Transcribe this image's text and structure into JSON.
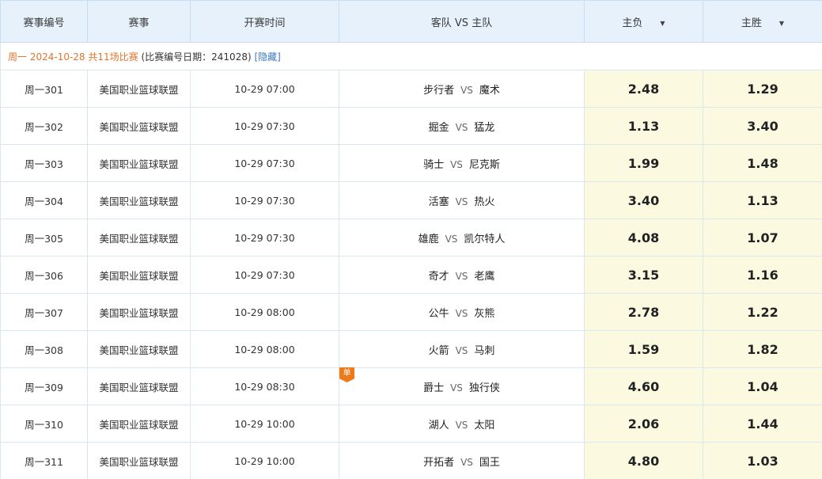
{
  "headers": {
    "code": "赛事编号",
    "league": "赛事",
    "time": "开赛时间",
    "teams": "客队 VS 主队",
    "away_win": "主负",
    "home_win": "主胜",
    "sort_icon": "▼"
  },
  "info": {
    "date": "周一 2024-10-28 共11场比赛",
    "note": "(比赛编号日期：241028)",
    "hide_link": "[隐藏]"
  },
  "vs_label": "VS",
  "single_badge": "单",
  "colors": {
    "odds_bg": "#fbfae1",
    "header_bg": "#e6f1fb",
    "date_color": "#e0762e",
    "badge": "#ef7a1a"
  },
  "matches": [
    {
      "code": "周一301",
      "league": "美国职业篮球联盟",
      "time": "10-29 07:00",
      "away": "步行者",
      "home": "魔术",
      "away_odds": "2.48",
      "home_odds": "1.29"
    },
    {
      "code": "周一302",
      "league": "美国职业篮球联盟",
      "time": "10-29 07:30",
      "away": "掘金",
      "home": "猛龙",
      "away_odds": "1.13",
      "home_odds": "3.40"
    },
    {
      "code": "周一303",
      "league": "美国职业篮球联盟",
      "time": "10-29 07:30",
      "away": "骑士",
      "home": "尼克斯",
      "away_odds": "1.99",
      "home_odds": "1.48"
    },
    {
      "code": "周一304",
      "league": "美国职业篮球联盟",
      "time": "10-29 07:30",
      "away": "活塞",
      "home": "热火",
      "away_odds": "3.40",
      "home_odds": "1.13"
    },
    {
      "code": "周一305",
      "league": "美国职业篮球联盟",
      "time": "10-29 07:30",
      "away": "雄鹿",
      "home": "凯尔特人",
      "away_odds": "4.08",
      "home_odds": "1.07"
    },
    {
      "code": "周一306",
      "league": "美国职业篮球联盟",
      "time": "10-29 07:30",
      "away": "奇才",
      "home": "老鹰",
      "away_odds": "3.15",
      "home_odds": "1.16"
    },
    {
      "code": "周一307",
      "league": "美国职业篮球联盟",
      "time": "10-29 08:00",
      "away": "公牛",
      "home": "灰熊",
      "away_odds": "2.78",
      "home_odds": "1.22"
    },
    {
      "code": "周一308",
      "league": "美国职业篮球联盟",
      "time": "10-29 08:00",
      "away": "火箭",
      "home": "马刺",
      "away_odds": "1.59",
      "home_odds": "1.82"
    },
    {
      "code": "周一309",
      "league": "美国职业篮球联盟",
      "time": "10-29 08:30",
      "away": "爵士",
      "home": "独行侠",
      "away_odds": "4.60",
      "home_odds": "1.04",
      "single": true
    },
    {
      "code": "周一310",
      "league": "美国职业篮球联盟",
      "time": "10-29 10:00",
      "away": "湖人",
      "home": "太阳",
      "away_odds": "2.06",
      "home_odds": "1.44"
    },
    {
      "code": "周一311",
      "league": "美国职业篮球联盟",
      "time": "10-29 10:00",
      "away": "开拓者",
      "home": "国王",
      "away_odds": "4.80",
      "home_odds": "1.03"
    }
  ]
}
